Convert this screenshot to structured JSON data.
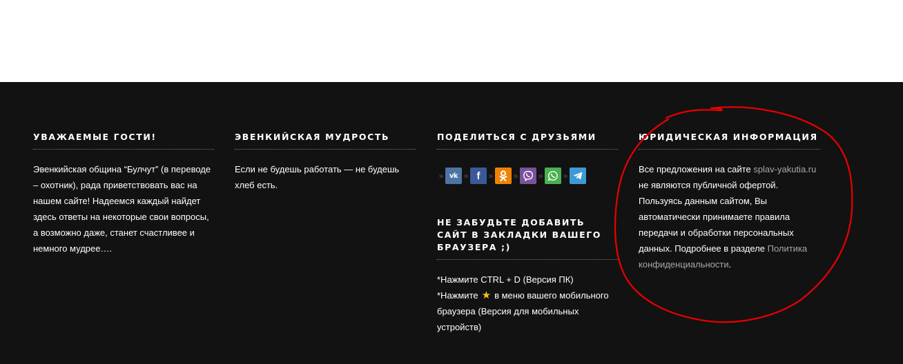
{
  "colors": {
    "footer_bg": "#121212",
    "link": "#a8a8a8",
    "vk": "#4c75a3",
    "facebook": "#3b5998",
    "odnoklassniki": "#ee8208",
    "viber": "#7b519d",
    "whatsapp": "#4caf50",
    "telegram": "#3d9ad4",
    "star": "#f5c518",
    "annotation": "#e60000"
  },
  "guests": {
    "title": "Уважаемые гости!",
    "text": "Эвенкийская община “Булчут” (в переводе – охотник), рада приветствовать вас на нашем сайте! Надеемся каждый найдет здесь ответы на некоторые свои вопросы, а возможно даже, станет счастливее и немного мудрее…."
  },
  "wisdom": {
    "title": "Эвенкийская мудрость",
    "text": "Если не будешь работать — не будешь хлеб есть."
  },
  "share": {
    "title": "Поделиться с друзьями",
    "separator": "»",
    "icons": [
      {
        "name": "vk-icon",
        "glyph": "vk"
      },
      {
        "name": "facebook-icon",
        "glyph": "f"
      },
      {
        "name": "odnoklassniki-icon",
        "glyph": "ok"
      },
      {
        "name": "viber-icon",
        "glyph": "phone"
      },
      {
        "name": "whatsapp-icon",
        "glyph": "phone"
      },
      {
        "name": "telegram-icon",
        "glyph": "plane"
      }
    ]
  },
  "bookmark": {
    "title": "Не забудьте добавить сайт в закладки вашего браузера ;)",
    "pc_tip": "*Нажмите CTRL + D (Версия ПК)",
    "mobile_prefix": "*Нажмите",
    "star": "★",
    "mobile_suffix": "в меню вашего мобильного браузера (Версия для мобильных устройств)"
  },
  "legal": {
    "title": "Юридическая информация",
    "text_1": "Все предложения на сайте ",
    "site_link": "splav-yakutia.ru",
    "text_2": " не являются публичной офертой. Пользуясь данным сайтом, Вы автоматически принимаете правила передачи и обработки персональных данных. Подробнее в разделе ",
    "policy_link": "Политика конфиденциальности",
    "text_3": "."
  }
}
